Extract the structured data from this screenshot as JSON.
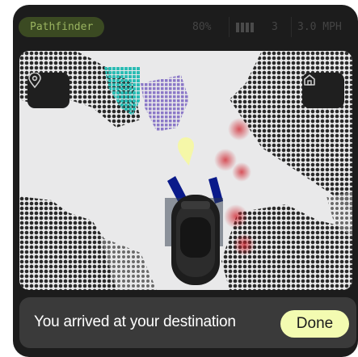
{
  "header": {
    "app_name": "Pathfinder",
    "battery": "80%",
    "signal_count": "3",
    "speed": "3.0 MPH"
  },
  "map": {
    "locate_button_icon": "location-pin-icon",
    "home_button_icon": "home-icon",
    "destination_marker_icon": "destination-pin-icon",
    "destination_marker_color": "#f5f7a8"
  },
  "notification": {
    "message": "You arrived at your destination",
    "done_label": "Done"
  },
  "colors": {
    "accent": "#f3fbb1",
    "pill_background": "#3b4a22",
    "pill_text": "#9ab460",
    "panel_background": "#1c1c1c"
  }
}
